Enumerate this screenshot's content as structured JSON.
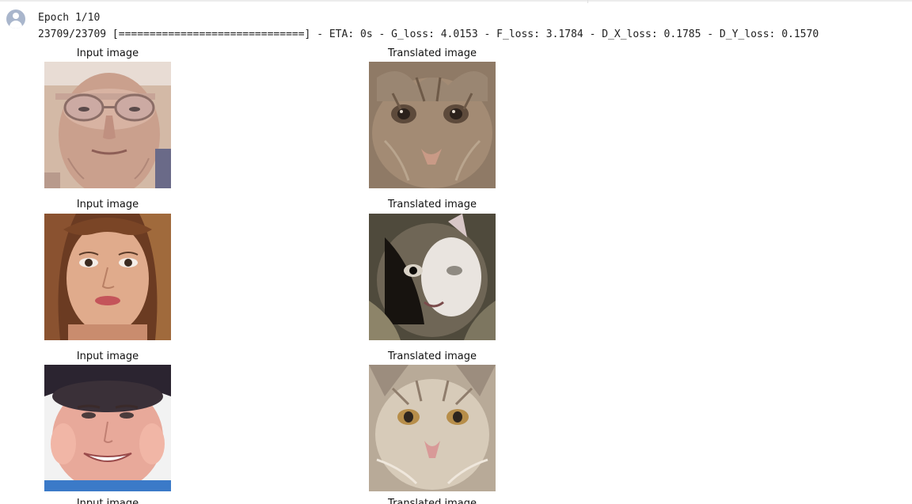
{
  "cell": {
    "epoch_line": "Epoch 1/10",
    "progress_line": "23709/23709 [==============================] - ETA: 0s - G_loss: 4.0153 - F_loss: 3.1784 - D_X_loss: 0.1785 - D_Y_loss: 0.1570"
  },
  "figures": [
    {
      "input_title": "Input image",
      "translated_title": "Translated image",
      "input_picture": "elderly man with glasses face",
      "translated_picture": "generated cat face, brown tabby"
    },
    {
      "input_title": "Input image",
      "translated_title": "Translated image",
      "input_picture": "young girl with long hair face",
      "translated_picture": "generated cat face, black and white"
    },
    {
      "input_title": "Input image",
      "translated_title": "Translated image",
      "input_picture": "smiling boy face",
      "translated_picture": "generated cat face, light tabby"
    },
    {
      "input_title": "Input image",
      "translated_title": "Translated image"
    }
  ],
  "icons": {
    "output_prompt": "user-avatar-icon"
  }
}
